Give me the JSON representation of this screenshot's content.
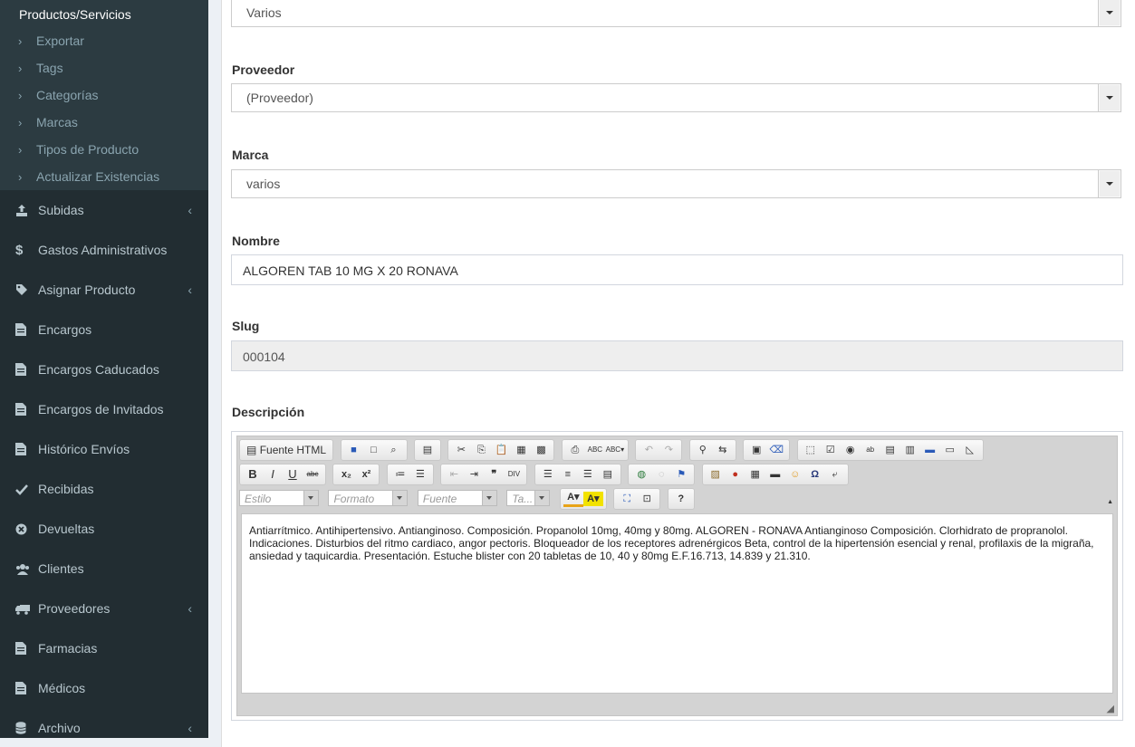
{
  "sidebar": {
    "section_title": "Productos/Servicios",
    "sub_items": [
      "Exportar",
      "Tags",
      "Categorías",
      "Marcas",
      "Tipos de Producto",
      "Actualizar Existencias"
    ],
    "items": [
      {
        "label": "Subidas",
        "icon": "upload-icon",
        "caret": "‹"
      },
      {
        "label": "Gastos Administrativos",
        "icon": "dollar-icon",
        "caret": ""
      },
      {
        "label": "Asignar Producto",
        "icon": "tag-icon",
        "caret": "‹"
      },
      {
        "label": "Encargos",
        "icon": "file-icon",
        "caret": ""
      },
      {
        "label": "Encargos Caducados",
        "icon": "file-icon",
        "caret": ""
      },
      {
        "label": "Encargos de Invitados",
        "icon": "file-icon",
        "caret": ""
      },
      {
        "label": "Histórico Envíos",
        "icon": "file-icon",
        "caret": ""
      },
      {
        "label": "Recibidas",
        "icon": "check-icon",
        "caret": ""
      },
      {
        "label": "Devueltas",
        "icon": "times-circle-icon",
        "caret": ""
      },
      {
        "label": "Clientes",
        "icon": "users-icon",
        "caret": ""
      },
      {
        "label": "Proveedores",
        "icon": "truck-icon",
        "caret": "‹"
      },
      {
        "label": "Farmacias",
        "icon": "file-icon",
        "caret": ""
      },
      {
        "label": "Médicos",
        "icon": "file-icon",
        "caret": ""
      },
      {
        "label": "Archivo",
        "icon": "database-icon",
        "caret": "‹"
      }
    ]
  },
  "form": {
    "tipo_value": "Varios",
    "proveedor_label": "Proveedor",
    "proveedor_value": "(Proveedor)",
    "marca_label": "Marca",
    "marca_value": "varios",
    "nombre_label": "Nombre",
    "nombre_value": "ALGOREN TAB 10 MG X 20 RONAVA",
    "slug_label": "Slug",
    "slug_value": "000104",
    "descripcion_label": "Descripción"
  },
  "editor": {
    "source_label": "Fuente HTML",
    "combos": [
      "Estilo",
      "Formato",
      "Fuente",
      "Ta..."
    ],
    "content": "Antiarrítmico. Antihipertensivo. Antianginoso. Composición. Propanolol 10mg, 40mg y 80mg. ALGOREN - RONAVA Antianginoso Composición. Clorhidrato de propranolol. Indicaciones. Disturbios del ritmo cardiaco, angor pectoris. Bloqueador de los receptores adrenérgicos Beta, control de la hipertensión esencial y renal, profilaxis de la migraña, ansiedad y taquicardia. Presentación. Estuche blister con 20 tabletas de 10, 40 y 80mg E.F.16.713, 14.839 y 21.310."
  },
  "colors": {
    "sidebar_bg": "#222d32",
    "submenu_bg": "#2c3b41",
    "page_bg": "#ecf0f5"
  }
}
